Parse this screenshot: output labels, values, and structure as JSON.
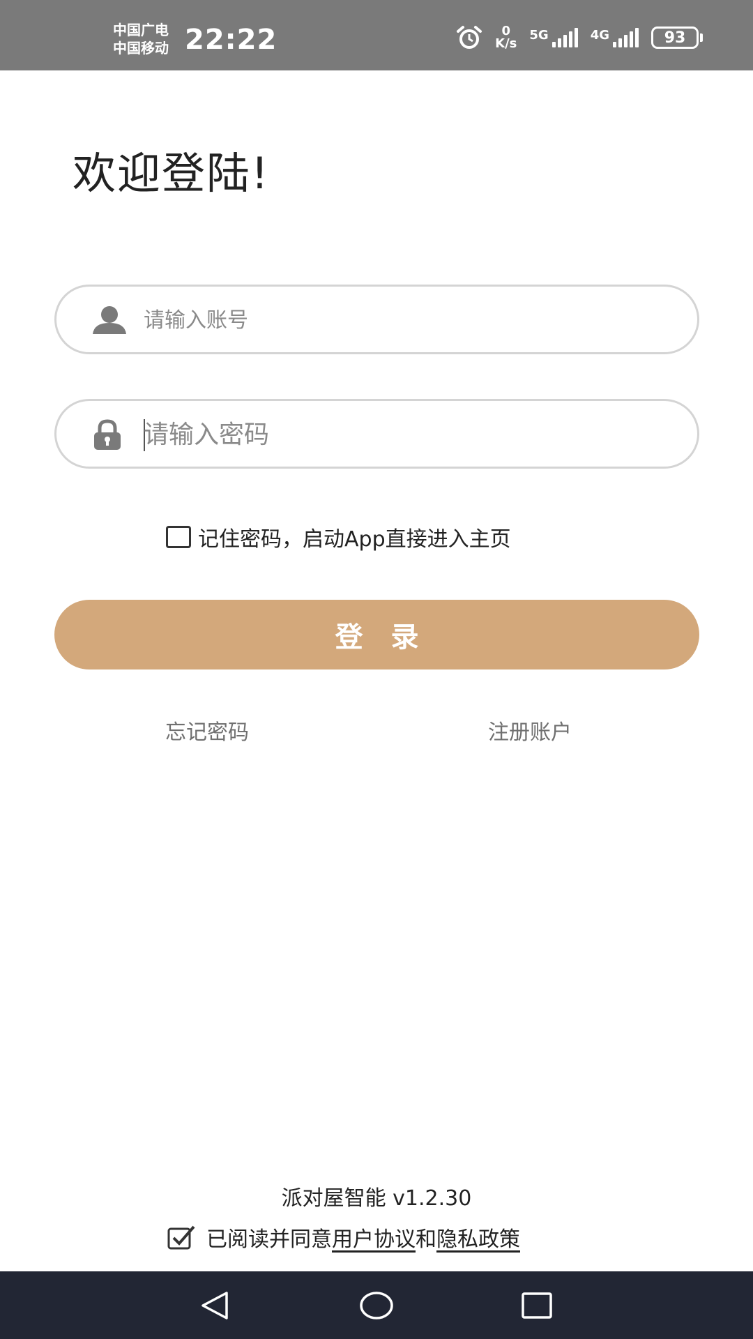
{
  "status_bar": {
    "carrier_1": "中国广电",
    "carrier_2": "中国移动",
    "time": "22:22",
    "net_speed_value": "0",
    "net_speed_unit": "K/s",
    "sim1_tech": "5G",
    "sim2_tech": "4G",
    "battery": "93",
    "icons": [
      "alarm-icon",
      "signal-icon",
      "battery-icon"
    ]
  },
  "welcome_title": "欢迎登陆!",
  "account_field": {
    "placeholder": "请输入账号",
    "icon": "user-icon"
  },
  "password_field": {
    "placeholder": "请输入密码",
    "icon": "lock-icon"
  },
  "remember": {
    "label": "记住密码，启动App直接进入主页",
    "checked": false
  },
  "login_button": {
    "label": "登录"
  },
  "links": {
    "forgot": "忘记密码",
    "register": "注册账户"
  },
  "footer": {
    "version": "派对屋智能 v1.2.30",
    "agree_prefix": "已阅读并同意",
    "user_agreement": "用户协议",
    "agree_and": "和",
    "privacy_policy": "隐私政策",
    "agreed": true
  },
  "colors": {
    "accent": "#d3a87b",
    "status_bar": "#7a7a7a",
    "nav_bar": "#222634"
  },
  "nav_bar": {
    "icons": [
      "back-icon",
      "home-icon",
      "recent-apps-icon"
    ]
  }
}
